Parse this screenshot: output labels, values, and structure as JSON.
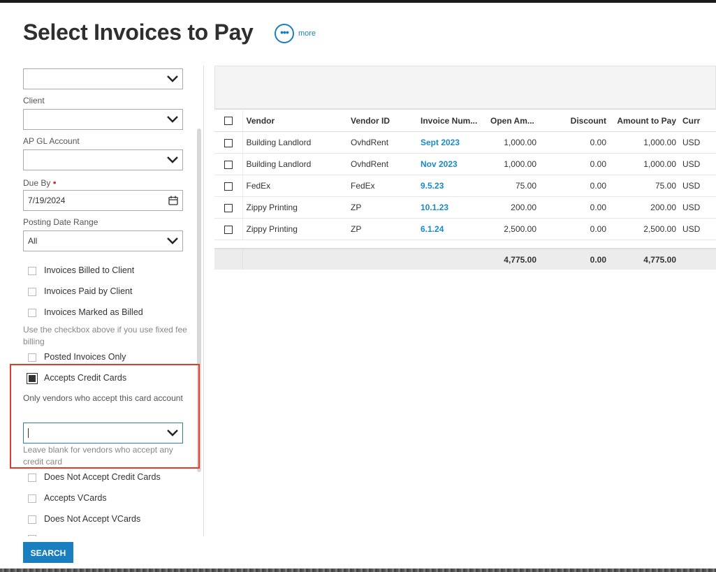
{
  "modal": {
    "title": "Select Invoices to Pay",
    "more_label": "more",
    "search_label": "SEARCH"
  },
  "filters": {
    "client_label": "Client",
    "ap_gl_label": "AP GL Account",
    "due_by_label": "Due By",
    "due_by_value": "7/19/2024",
    "posting_range_label": "Posting Date Range",
    "posting_range_value": "All",
    "checkboxes": [
      {
        "label": "Invoices Billed to Client",
        "checked": false
      },
      {
        "label": "Invoices Paid by Client",
        "checked": false
      },
      {
        "label": "Invoices Marked as Billed",
        "checked": false
      },
      {
        "label": "Posted Invoices Only",
        "checked": false
      },
      {
        "label": "Accepts Credit Cards",
        "checked": true
      },
      {
        "label": "Does Not Accept Credit Cards",
        "checked": false
      },
      {
        "label": "Accepts VCards",
        "checked": false
      },
      {
        "label": "Does Not Accept VCards",
        "checked": false
      }
    ],
    "fixed_fee_help": "Use the checkbox above if you use fixed fee billing",
    "card_account_label": "Only vendors who accept this card account",
    "card_account_help": "Leave blank for vendors who accept any credit card"
  },
  "grid": {
    "columns": [
      "Vendor",
      "Vendor ID",
      "Invoice Num...",
      "Open Am...",
      "Discount",
      "Amount to Pay",
      "Curr"
    ],
    "rows": [
      {
        "vendor": "Building Landlord",
        "vendor_id": "OvhdRent",
        "invoice": "Sept 2023",
        "open": "1,000.00",
        "discount": "0.00",
        "amount": "1,000.00",
        "curr": "USD"
      },
      {
        "vendor": "Building Landlord",
        "vendor_id": "OvhdRent",
        "invoice": "Nov 2023",
        "open": "1,000.00",
        "discount": "0.00",
        "amount": "1,000.00",
        "curr": "USD"
      },
      {
        "vendor": "FedEx",
        "vendor_id": "FedEx",
        "invoice": "9.5.23",
        "open": "75.00",
        "discount": "0.00",
        "amount": "75.00",
        "curr": "USD"
      },
      {
        "vendor": "Zippy Printing",
        "vendor_id": "ZP",
        "invoice": "10.1.23",
        "open": "200.00",
        "discount": "0.00",
        "amount": "200.00",
        "curr": "USD"
      },
      {
        "vendor": "Zippy Printing",
        "vendor_id": "ZP",
        "invoice": "6.1.24",
        "open": "2,500.00",
        "discount": "0.00",
        "amount": "2,500.00",
        "curr": "USD"
      }
    ],
    "totals": {
      "open": "4,775.00",
      "discount": "0.00",
      "amount": "4,775.00"
    }
  }
}
